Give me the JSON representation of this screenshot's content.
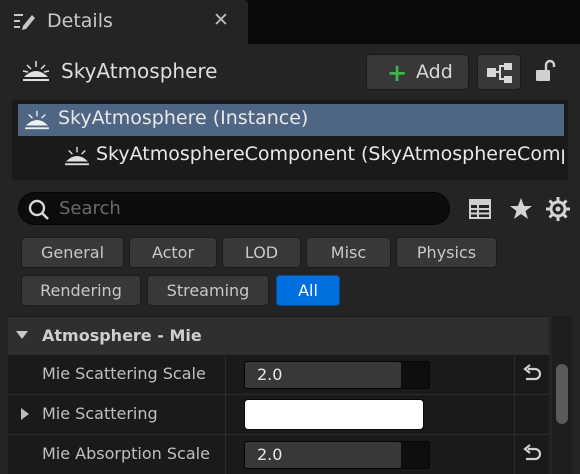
{
  "tab": {
    "title": "Details",
    "close_glyph": "✕",
    "icon": "details-pencil-icon"
  },
  "header": {
    "actor_name": "SkyAtmosphere",
    "actor_icon": "sky-atmosphere-icon",
    "add_button": {
      "label": "Add",
      "icon": "plus-icon",
      "icon_color": "#3fb54a"
    },
    "blueprint_icon": "blueprint-hierarchy-icon",
    "lock_icon": "unlocked-padlock-icon"
  },
  "component_tree": {
    "items": [
      {
        "label": "SkyAtmosphere (Instance)",
        "selected": true
      },
      {
        "label": "SkyAtmosphereComponent (SkyAtmosphereCompone",
        "selected": false
      }
    ],
    "selection_color": "#4e6683"
  },
  "search": {
    "placeholder": "Search",
    "value": ""
  },
  "toolbar_icons": [
    "table-view-icon",
    "favorites-star-icon",
    "settings-gear-icon"
  ],
  "filters": {
    "row1": [
      "General",
      "Actor",
      "LOD",
      "Misc",
      "Physics"
    ],
    "row2": [
      "Rendering",
      "Streaming",
      "All"
    ],
    "active": "All",
    "active_color": "#0070e0"
  },
  "category": {
    "label": "Atmosphere - Mie",
    "expanded": true
  },
  "properties": [
    {
      "name": "Mie Scattering Scale",
      "value": "2.0",
      "fill_fraction": 0.85,
      "resettable": true,
      "type": "float"
    },
    {
      "name": "Mie Scattering",
      "value": "",
      "swatch_color": "#ffffff",
      "resettable": false,
      "type": "color",
      "expandable": true
    },
    {
      "name": "Mie Absorption Scale",
      "value": "2.0",
      "fill_fraction": 0.85,
      "resettable": true,
      "type": "float"
    }
  ]
}
